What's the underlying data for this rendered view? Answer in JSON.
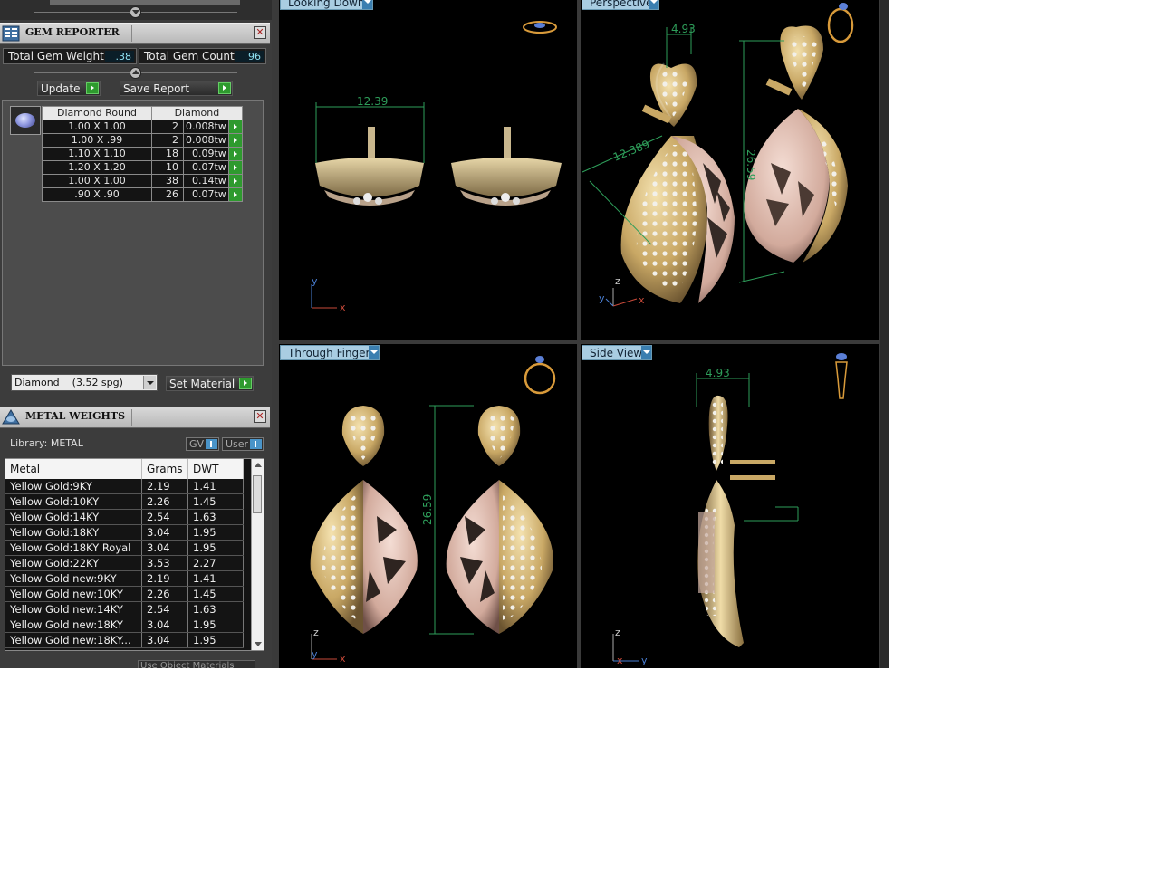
{
  "gem_reporter": {
    "title": "GEM REPORTER",
    "total_gem_weight_label": "Total Gem Weight",
    "total_gem_weight": ".38",
    "total_gem_count_label": "Total Gem Count",
    "total_gem_count": "96",
    "update_label": "Update",
    "save_report_label": "Save Report",
    "table": {
      "headers": [
        "Diamond Round",
        "Diamond"
      ],
      "rows": [
        {
          "size": "1.00 X 1.00",
          "count": "2",
          "weight": "0.008tw"
        },
        {
          "size": "1.00 X .99",
          "count": "2",
          "weight": "0.008tw"
        },
        {
          "size": "1.10 X 1.10",
          "count": "18",
          "weight": "0.09tw"
        },
        {
          "size": "1.20 X 1.20",
          "count": "10",
          "weight": "0.07tw"
        },
        {
          "size": "1.00 X 1.00",
          "count": "38",
          "weight": "0.14tw"
        },
        {
          "size": ".90 X .90",
          "count": "26",
          "weight": "0.07tw"
        }
      ]
    },
    "material_select": "Diamond    (3.52 spg)",
    "set_material_label": "Set Material"
  },
  "metal_weights": {
    "title": "METAL WEIGHTS",
    "library_label": "Library: METAL",
    "gv_label": "GV",
    "user_label": "User",
    "headers": [
      "Metal",
      "Grams",
      "DWT"
    ],
    "rows": [
      {
        "metal": "Yellow Gold:9KY",
        "grams": "2.19",
        "dwt": "1.41"
      },
      {
        "metal": "Yellow Gold:10KY",
        "grams": "2.26",
        "dwt": "1.45"
      },
      {
        "metal": "Yellow Gold:14KY",
        "grams": "2.54",
        "dwt": "1.63"
      },
      {
        "metal": "Yellow Gold:18KY",
        "grams": "3.04",
        "dwt": "1.95"
      },
      {
        "metal": "Yellow Gold:18KY Royal",
        "grams": "3.04",
        "dwt": "1.95"
      },
      {
        "metal": "Yellow Gold:22KY",
        "grams": "3.53",
        "dwt": "2.27"
      },
      {
        "metal": "Yellow Gold new:9KY",
        "grams": "2.19",
        "dwt": "1.41"
      },
      {
        "metal": "Yellow Gold new:10KY",
        "grams": "2.26",
        "dwt": "1.45"
      },
      {
        "metal": "Yellow Gold new:14KY",
        "grams": "2.54",
        "dwt": "1.63"
      },
      {
        "metal": "Yellow Gold new:18KY",
        "grams": "3.04",
        "dwt": "1.95"
      },
      {
        "metal": "Yellow Gold new:18KY...",
        "grams": "3.04",
        "dwt": "1.95"
      }
    ],
    "use_object_materials_label": "Use Object Materials"
  },
  "viewports": {
    "looking_down": {
      "label": "Looking Down",
      "dimension": "12.39",
      "axis_a": "y",
      "axis_b": "x"
    },
    "perspective": {
      "label": "Perspective",
      "dim_width": "4.93",
      "dim_diag": "12.389",
      "dim_height": "26.59",
      "axis_x": "x",
      "axis_y": "y",
      "axis_z": "z"
    },
    "through_finger": {
      "label": "Through Finger",
      "dimension": "26.59",
      "axis_x": "x",
      "axis_y": "y",
      "axis_z": "z"
    },
    "side_view": {
      "label": "Side View",
      "dimension": "4.93",
      "axis_x": "x",
      "axis_y": "y",
      "axis_z": "z"
    }
  },
  "colors": {
    "gold": "#c9a865",
    "rose": "#d8b2a6",
    "dimension_green": "#2e9e5a",
    "tab_blue": "#a9cde2"
  }
}
